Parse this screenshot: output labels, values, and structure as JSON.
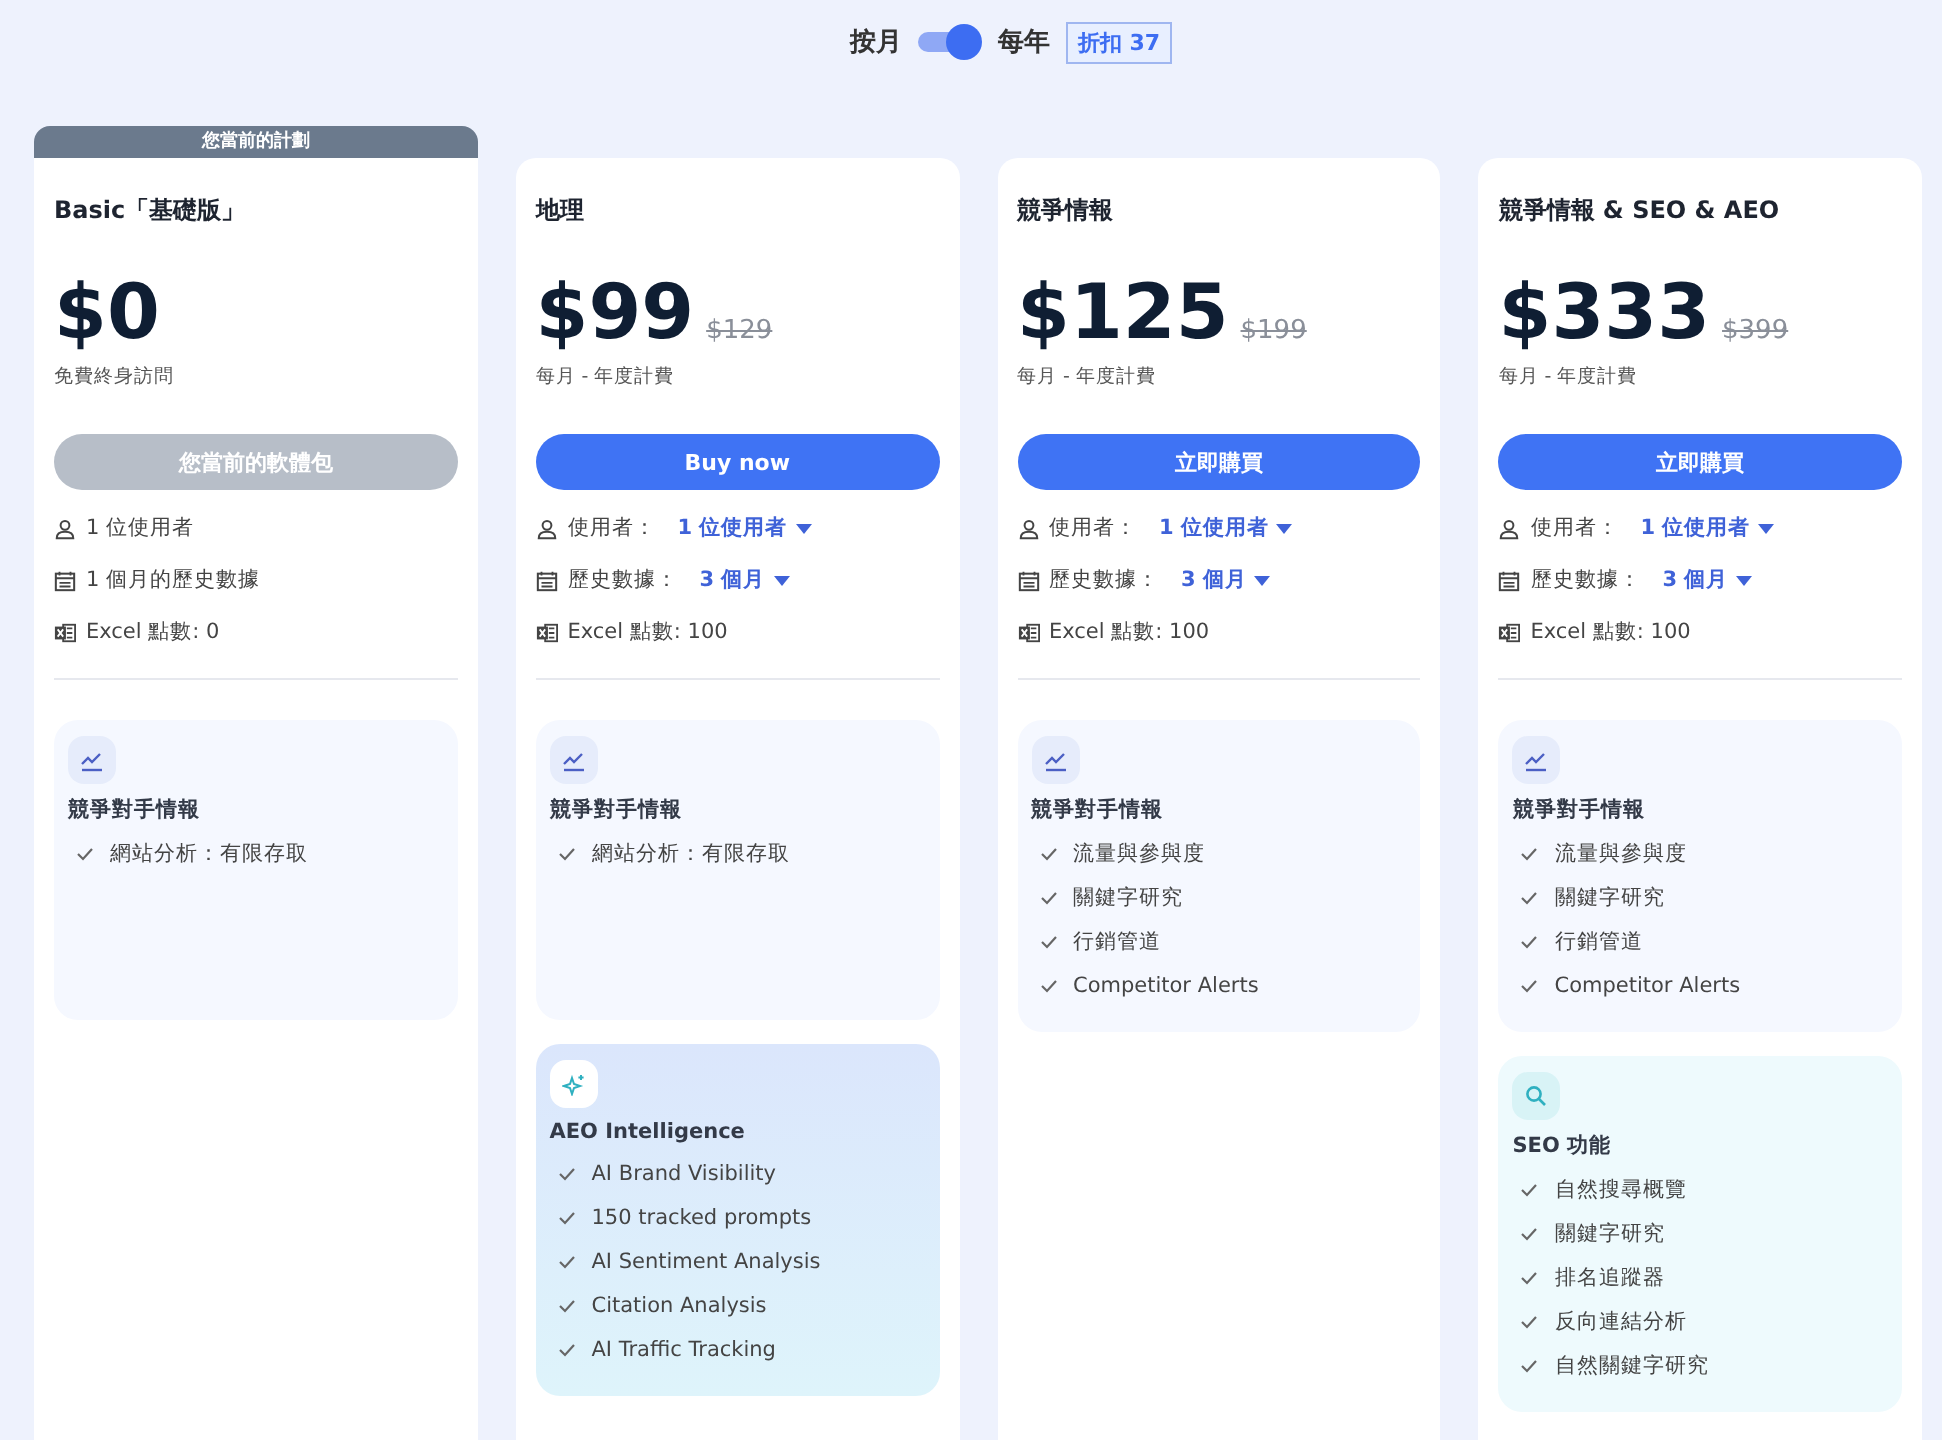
{
  "billing": {
    "monthly_label": "按月",
    "yearly_label": "每年",
    "yearly_selected": true,
    "discount": "折扣 37"
  },
  "plans": [
    {
      "name": "Basic「基礎版」",
      "current": true,
      "banner": "您當前的計劃",
      "price": "$0",
      "period": "免費終身訪問",
      "button": {
        "label": "您當前的軟體包",
        "disabled": true
      },
      "specs": [
        {
          "kind": "users",
          "text": "1 位使用者"
        },
        {
          "kind": "history",
          "text": "1 個月的歷史數據"
        },
        {
          "kind": "excel",
          "text": "Excel 點數: 0"
        }
      ],
      "groups": [
        {
          "kind": "competitor",
          "title": "競爭對手情報",
          "items": [
            "網站分析：有限存取"
          ]
        }
      ]
    },
    {
      "name": "地理",
      "current": false,
      "price": "$99",
      "old_price": "$129",
      "period": "每月 - 年度計費",
      "button": {
        "label": "Buy now",
        "disabled": false
      },
      "specs": [
        {
          "kind": "users",
          "text": "使用者：",
          "value": "1 位使用者"
        },
        {
          "kind": "history",
          "text": "歷史數據：",
          "value": "3 個月"
        },
        {
          "kind": "excel",
          "text": "Excel 點數: 100"
        }
      ],
      "groups": [
        {
          "kind": "competitor",
          "title": "競爭對手情報",
          "items": [
            "網站分析：有限存取"
          ]
        },
        {
          "kind": "aeo",
          "title": "AEO Intelligence",
          "items": [
            "AI Brand Visibility",
            "150 tracked prompts",
            "AI Sentiment Analysis",
            "Citation Analysis",
            "AI Traffic Tracking"
          ]
        }
      ]
    },
    {
      "name": "競爭情報",
      "current": false,
      "price": "$125",
      "old_price": "$199",
      "period": "每月 - 年度計費",
      "button": {
        "label": "立即購買",
        "disabled": false
      },
      "specs": [
        {
          "kind": "users",
          "text": "使用者：",
          "value": "1 位使用者"
        },
        {
          "kind": "history",
          "text": "歷史數據：",
          "value": "3 個月"
        },
        {
          "kind": "excel",
          "text": "Excel 點數: 100"
        }
      ],
      "groups": [
        {
          "kind": "competitor",
          "title": "競爭對手情報",
          "items": [
            "流量與參與度",
            "關鍵字研究",
            "行銷管道",
            "Competitor Alerts"
          ]
        }
      ]
    },
    {
      "name": "競爭情報 & SEO & AEO",
      "current": false,
      "price": "$333",
      "old_price": "$399",
      "period": "每月 - 年度計費",
      "button": {
        "label": "立即購買",
        "disabled": false
      },
      "specs": [
        {
          "kind": "users",
          "text": "使用者：",
          "value": "1 位使用者"
        },
        {
          "kind": "history",
          "text": "歷史數據：",
          "value": "3 個月"
        },
        {
          "kind": "excel",
          "text": "Excel 點數: 100"
        }
      ],
      "groups": [
        {
          "kind": "competitor",
          "title": "競爭對手情報",
          "items": [
            "流量與參與度",
            "關鍵字研究",
            "行銷管道",
            "Competitor Alerts"
          ]
        },
        {
          "kind": "seo",
          "title": "SEO 功能",
          "items": [
            "自然搜尋概覽",
            "關鍵字研究",
            "排名追蹤器",
            "反向連結分析",
            "自然關鍵字研究"
          ]
        }
      ]
    }
  ]
}
